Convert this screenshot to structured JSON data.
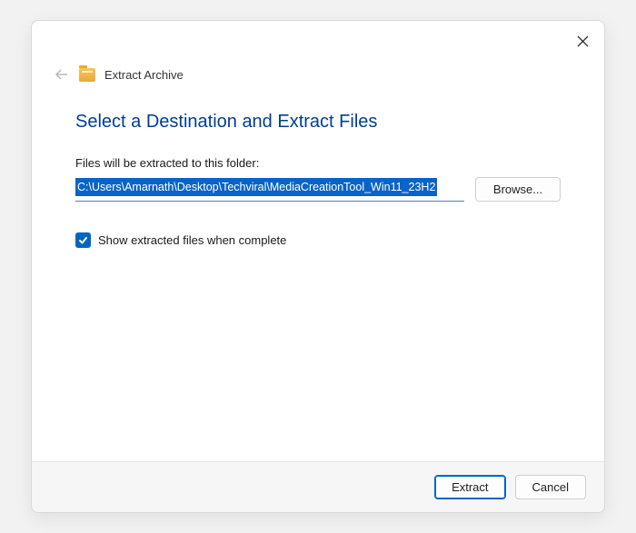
{
  "header": {
    "title": "Extract Archive"
  },
  "main": {
    "heading": "Select a Destination and Extract Files",
    "field_label": "Files will be extracted to this folder:",
    "path_value": "C:\\Users\\Amarnath\\Desktop\\Techviral\\MediaCreationTool_Win11_23H2",
    "browse_label": "Browse...",
    "checkbox_label": "Show extracted files when complete",
    "checkbox_checked": true
  },
  "footer": {
    "extract_label": "Extract",
    "cancel_label": "Cancel"
  }
}
